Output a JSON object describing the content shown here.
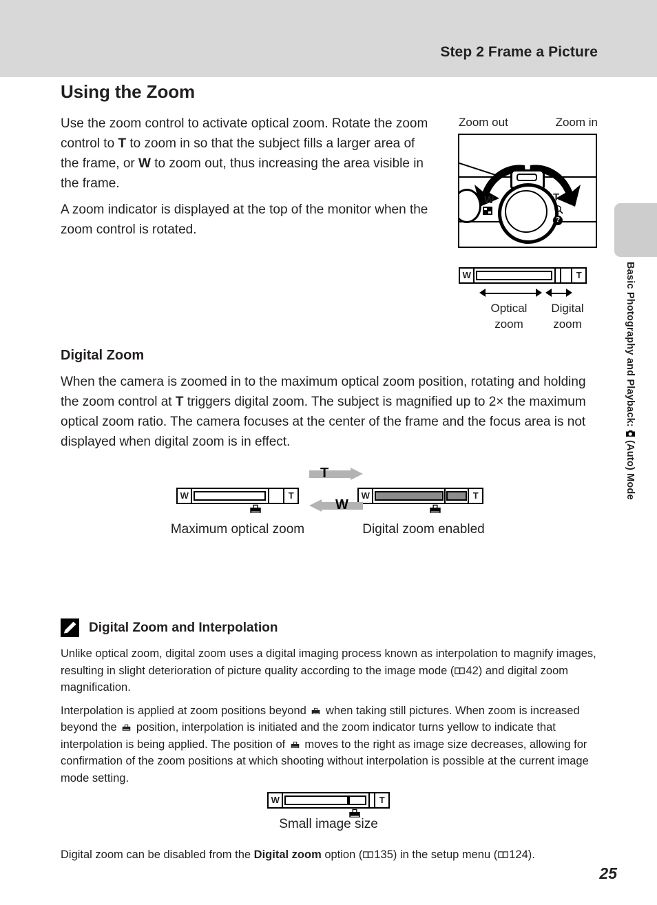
{
  "header": {
    "title": "Step 2 Frame a Picture"
  },
  "side_tab": {
    "label_part1": "Basic Photography and Playback: ",
    "icon": "camera-auto-icon",
    "label_part2": " (Auto) Mode"
  },
  "main": {
    "section_title": "Using the Zoom",
    "intro_p1_a": "Use the zoom control to activate optical zoom. Rotate the zoom control to ",
    "intro_p1_t": "T",
    "intro_p1_b": " to zoom in so that the subject fills a larger area of the frame, or ",
    "intro_p1_w": "W",
    "intro_p1_c": " to zoom out, thus increasing the area visible in the frame.",
    "intro_p2": "A zoom indicator is displayed at the top of the monitor when the zoom control is rotated.",
    "sub_title": "Digital Zoom",
    "digital_p1_a": "When the camera is zoomed in to the maximum optical zoom position, rotating and holding the zoom control at ",
    "digital_p1_t": "T",
    "digital_p1_b": " triggers digital zoom. The subject is magnified up to 2× the maximum optical zoom ratio. The camera focuses at the center of the frame and the focus area is not displayed when digital zoom is in effect."
  },
  "camera_figure": {
    "zoom_out_label": "Zoom out",
    "zoom_in_label": "Zoom in",
    "dial_w": "W",
    "dial_t": "T",
    "help_badge": "?",
    "wide_icon": "thumbnail-view-icon",
    "tele_icon": "magnify-icon",
    "help_icon": "help-icon"
  },
  "zoom_indicator_figure": {
    "bar_w": "W",
    "bar_t": "T",
    "optical_label_l1": "Optical",
    "optical_label_l2": "zoom",
    "digital_label_l1": "Digital",
    "digital_label_l2": "zoom"
  },
  "zoom_states_figure": {
    "bar_w": "W",
    "bar_t": "T",
    "arrow_t": "T",
    "arrow_w": "W",
    "caption_left": "Maximum optical zoom",
    "caption_right": "Digital zoom enabled"
  },
  "note": {
    "title": "Digital Zoom and Interpolation",
    "icon": "pencil-note-icon",
    "p1_a": "Unlike optical zoom, digital zoom uses a digital imaging process known as interpolation to magnify images, resulting in slight deterioration of picture quality according to the image mode (",
    "p1_ref": "42",
    "p1_b": ") and digital zoom magnification.",
    "p2_a": "Interpolation is applied at zoom positions beyond ",
    "p2_b": " when taking still pictures. When zoom is increased beyond the ",
    "p2_c": " position, interpolation is initiated and the zoom indicator turns yellow to indicate that interpolation is being applied. The position of ",
    "p2_d": " moves to the right as image size decreases, allowing for confirmation of the zoom positions at which shooting without interpolation is possible at the current image mode setting.",
    "small_image_caption": "Small image size",
    "bar_w": "W",
    "bar_t": "T"
  },
  "footer": {
    "line_a": "Digital zoom can be disabled from the ",
    "line_bold": "Digital zoom",
    "line_b": " option (",
    "ref1": "135",
    "line_c": ") in the setup menu (",
    "ref2": "124",
    "line_d": ").",
    "page_number": "25"
  },
  "colors": {
    "header_band": "#d8d8d8",
    "side_tab": "#cdcdcd",
    "bar_fill": "#8c8c8c",
    "block_arrow": "#b3b3b3",
    "ink": "#231f20"
  }
}
